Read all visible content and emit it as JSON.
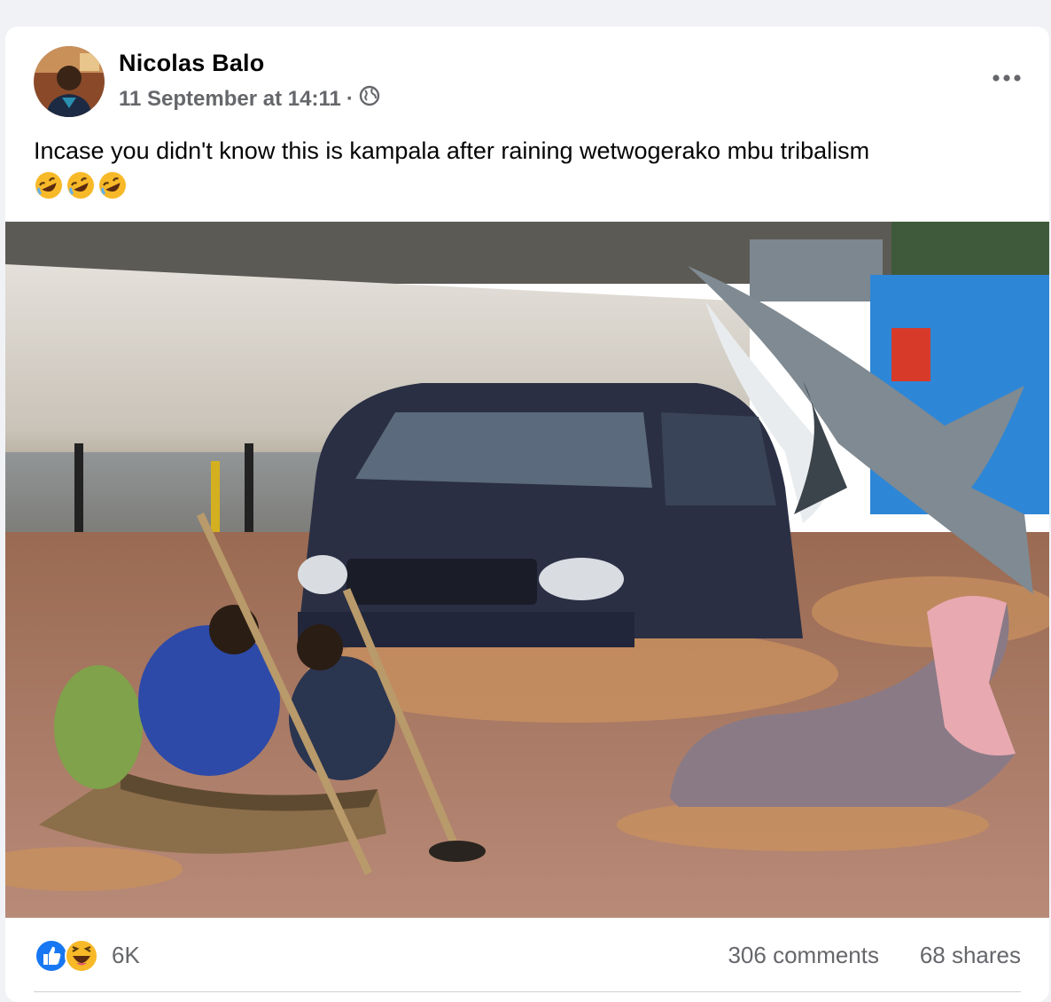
{
  "post": {
    "author": "Nicolas Balo",
    "timestamp": "11 September at 14:11",
    "separator": "·",
    "audience_icon": "globe-icon",
    "more_icon": "more-options-icon",
    "text": "Incase you didn't know this is kampala after raining wetwogerako mbu tribalism",
    "emojis": [
      "rofl-emoji",
      "rofl-emoji",
      "rofl-emoji"
    ]
  },
  "reactions": {
    "icons": [
      "like-icon",
      "haha-icon"
    ],
    "count": "6K",
    "comments": "306 comments",
    "shares": "68 shares"
  },
  "colors": {
    "like_blue": "#1877f2",
    "haha_yellow": "#f7b928",
    "secondary_text": "#65676b",
    "primary_text": "#050505"
  }
}
